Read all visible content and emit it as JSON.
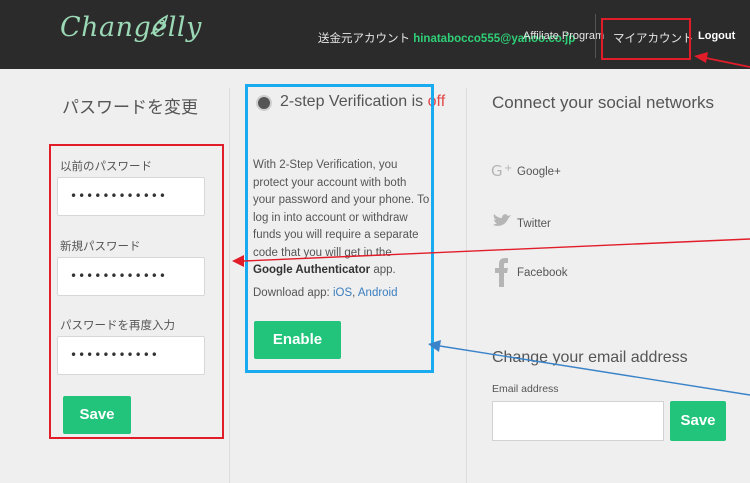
{
  "header": {
    "logo": "Changelly",
    "sender_prefix": "送金元アカウント",
    "sender_email": "hinatabocco555@yahoo.co.jp",
    "affiliate": "Affiliate Program",
    "account": "マイアカウント",
    "logout": "Logout"
  },
  "password": {
    "title": "パスワードを変更",
    "old_label": "以前のパスワード",
    "old_value": "••••••••••••",
    "new_label": "新規パスワード",
    "new_value": "••••••••••••",
    "confirm_label": "パスワードを再度入力",
    "confirm_value": "•••••••••••",
    "save": "Save"
  },
  "twostep": {
    "title": "2-step Verification is",
    "status": "off",
    "desc_1": "With 2-Step Verification, you protect your account with both your password and your phone. To log in into account or withdraw funds you will require a separate code that you will get in the",
    "desc_bold": "Google Authenticator",
    "desc_2": "app.",
    "download_prefix": "Download app:",
    "ios": "iOS",
    "sep": ",",
    "android": "Android",
    "enable": "Enable"
  },
  "social": {
    "title": "Connect your social networks",
    "google": "Google+",
    "twitter": "Twitter",
    "facebook": "Facebook"
  },
  "email": {
    "title": "Change your email address",
    "label": "Email address",
    "value": "",
    "save": "Save"
  },
  "colors": {
    "accent_green": "#21c47a",
    "annotation_red": "#e21d2a",
    "annotation_blue": "#19aaf0"
  }
}
